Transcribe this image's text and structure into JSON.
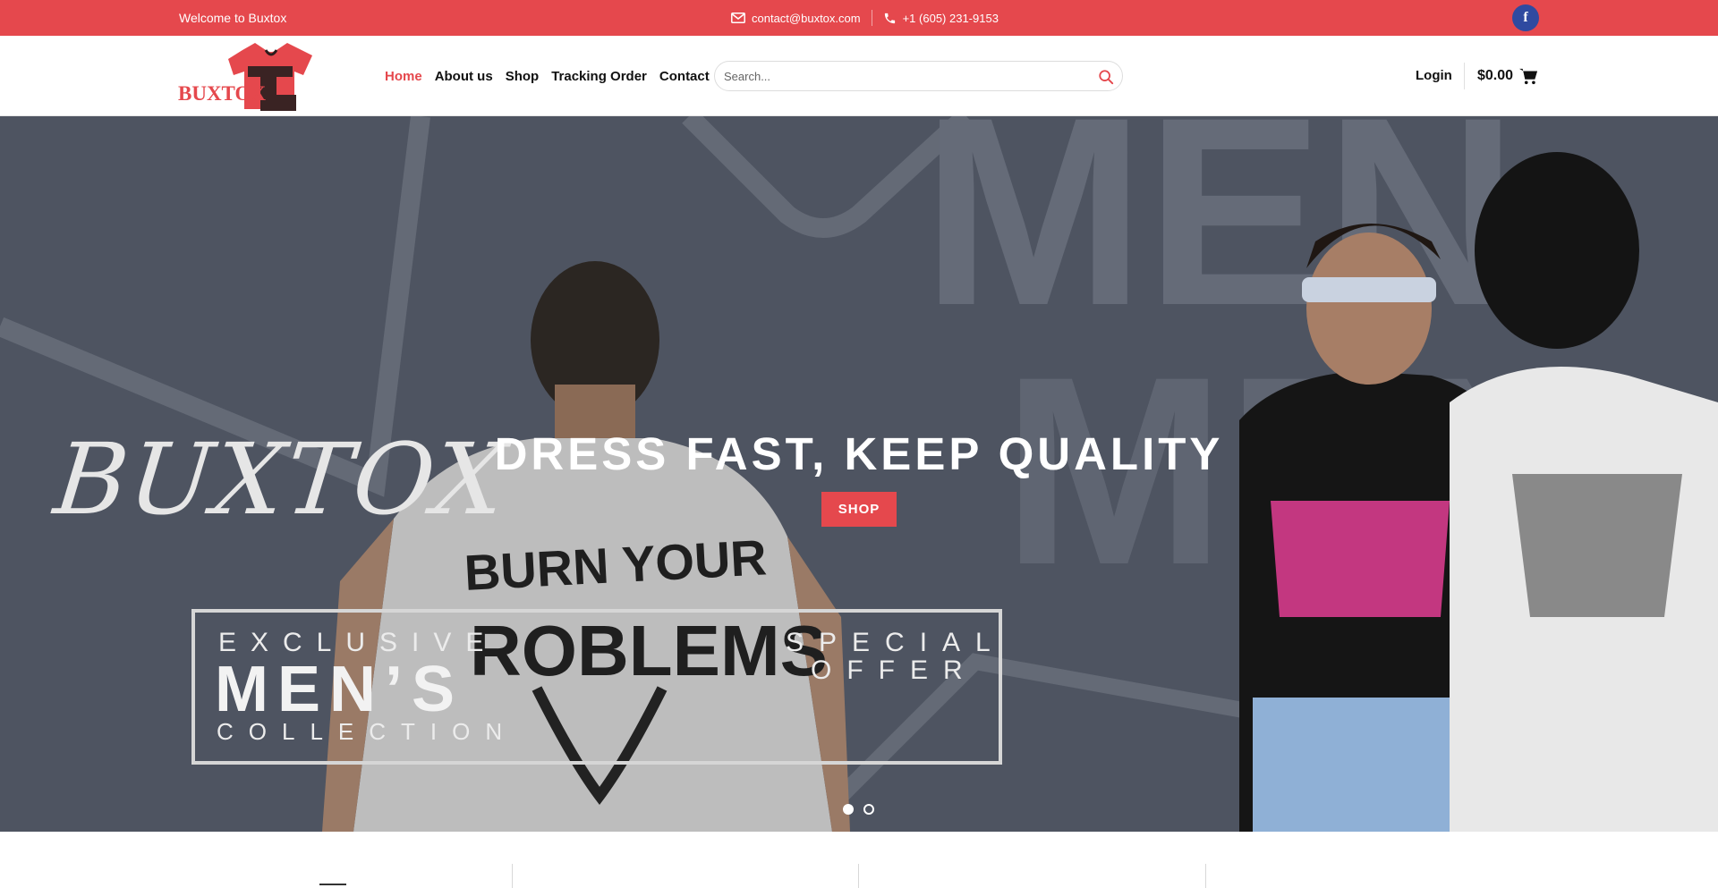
{
  "topbar": {
    "welcome": "Welcome to Buxtox",
    "email": "contact@buxtox.com",
    "phone": "+1 (605) 231-9153",
    "facebook_glyph": "f"
  },
  "header": {
    "logo_text": "BUXTOX",
    "nav": [
      {
        "label": "Home",
        "active": true
      },
      {
        "label": "About us",
        "active": false
      },
      {
        "label": "Shop",
        "active": false
      },
      {
        "label": "Tracking Order",
        "active": false
      },
      {
        "label": "Contact",
        "active": false
      }
    ],
    "search_placeholder": "Search...",
    "login": "Login",
    "cart_total": "$0.00"
  },
  "hero": {
    "brand_script": "BUXTOX",
    "exclusive": "EXCLUSIVE",
    "mens": "MEN’S",
    "collection": "COLLECTION",
    "special": "SPECIAL",
    "offer": "OFFER",
    "headline": "DRESS FAST, KEEP QUALITY",
    "shop_button": "SHOP",
    "slides": 2,
    "active_slide": 1
  },
  "colors": {
    "accent": "#e5484d",
    "hero_bg": "#4e5461",
    "facebook": "#2f4aa0"
  },
  "icons": [
    "mail-icon",
    "phone-icon",
    "facebook-icon",
    "search-icon",
    "cart-icon"
  ]
}
